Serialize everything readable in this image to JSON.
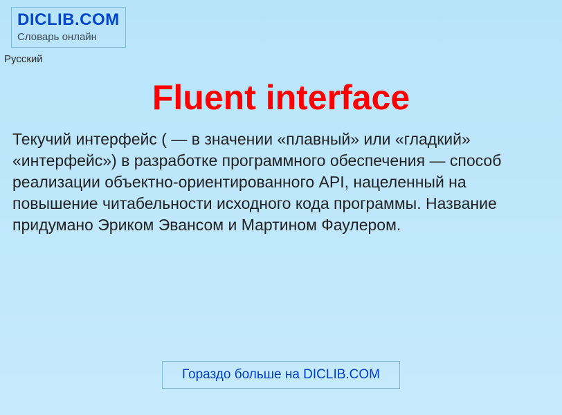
{
  "header": {
    "logo_title": "DICLIB.COM",
    "logo_subtitle": "Словарь онлайн"
  },
  "lang": {
    "current": "Русский"
  },
  "article": {
    "title": "Fluent interface",
    "body": "Текучий интерфейс ( — в значении «плавный» или «гладкий» «интерфейс») в разработке программного обеспечения — способ реализации объектно-ориентированного API, нацеленный на повышение читабельности исходного кода программы. Название придумано Эриком Эвансом и Мартином Фаулером."
  },
  "footer": {
    "more_link": "Гораздо больше на DICLIB.COM"
  }
}
